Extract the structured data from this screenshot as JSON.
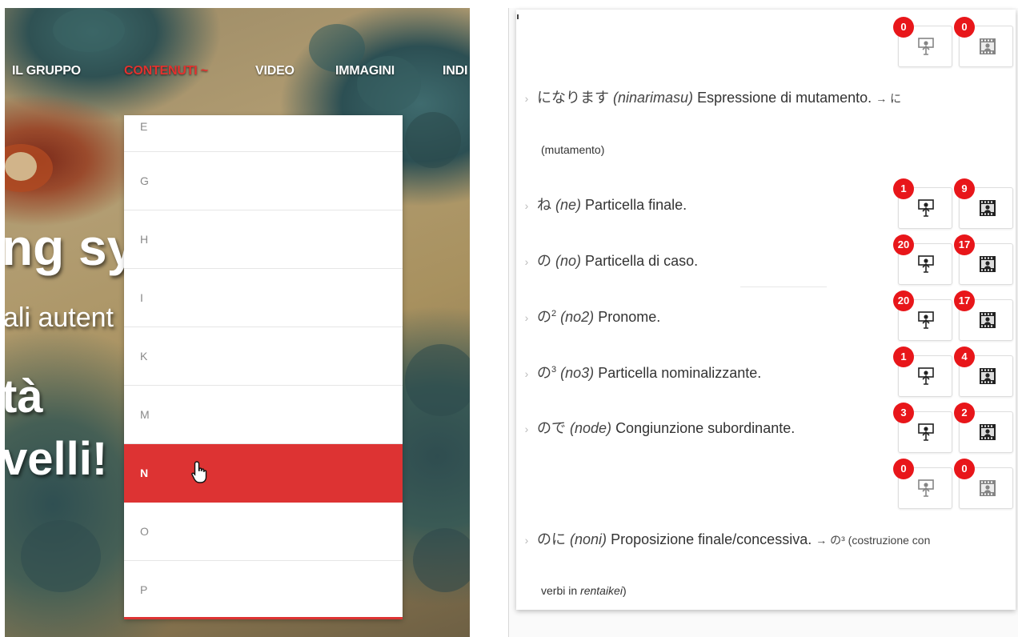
{
  "site_nav": {
    "items": [
      {
        "label": "IL GRUPPO"
      },
      {
        "label": "CONTENUTI ~"
      },
      {
        "label": "VIDEO"
      },
      {
        "label": "IMMAGINI"
      },
      {
        "label": "INDI"
      }
    ]
  },
  "hero": {
    "line1": "ng sy",
    "line2": "ali autent",
    "line3": "tà",
    "line4": "velli!"
  },
  "dropdown": {
    "items": [
      "E",
      "G",
      "H",
      "I",
      "K",
      "M",
      "N",
      "O",
      "P"
    ],
    "active": "N"
  },
  "dictionary": {
    "entries": [
      {
        "jp": "になります",
        "romaji": "(ninarimasu)",
        "desc": "Espressione di mutamento.",
        "xref": "→ に",
        "continuation": "(mutamento)"
      },
      {
        "jp": "ね",
        "romaji": "(ne)",
        "desc": "Particella finale."
      },
      {
        "jp": "の",
        "romaji": "(no)",
        "desc": "Particella di caso."
      },
      {
        "jp": "の",
        "sup": "2",
        "romaji": "(no2)",
        "desc": "Pronome."
      },
      {
        "jp": "の",
        "sup": "3",
        "romaji": "(no3)",
        "desc": "Particella nominalizzante."
      },
      {
        "jp": "ので",
        "romaji": "(node)",
        "desc": "Congiunzione subordinante."
      },
      {
        "jp": "のに",
        "romaji": "(noni)",
        "desc": "Proposizione finale/concessiva.",
        "xref": "→ の³ (costruzione con",
        "continuation_pre": "verbi in ",
        "continuation_em": "rentaikei",
        "continuation_post": ")"
      }
    ],
    "button_rows": [
      {
        "audio_count": "0",
        "video_count": "0"
      },
      {
        "audio_count": "1",
        "video_count": "9"
      },
      {
        "audio_count": "20",
        "video_count": "17"
      },
      {
        "audio_count": "20",
        "video_count": "17"
      },
      {
        "audio_count": "1",
        "video_count": "4"
      },
      {
        "audio_count": "3",
        "video_count": "2"
      },
      {
        "audio_count": "0",
        "video_count": "0"
      }
    ]
  },
  "colors": {
    "accent_red": "#dd3333",
    "badge_red": "#e8161a",
    "nav_active": "#e3312e"
  },
  "icons": {
    "audio_button": "presenter-icon",
    "video_button": "film-icon",
    "entry_bullet": "chevron-right-icon",
    "cursor": "hand-pointer-icon"
  }
}
